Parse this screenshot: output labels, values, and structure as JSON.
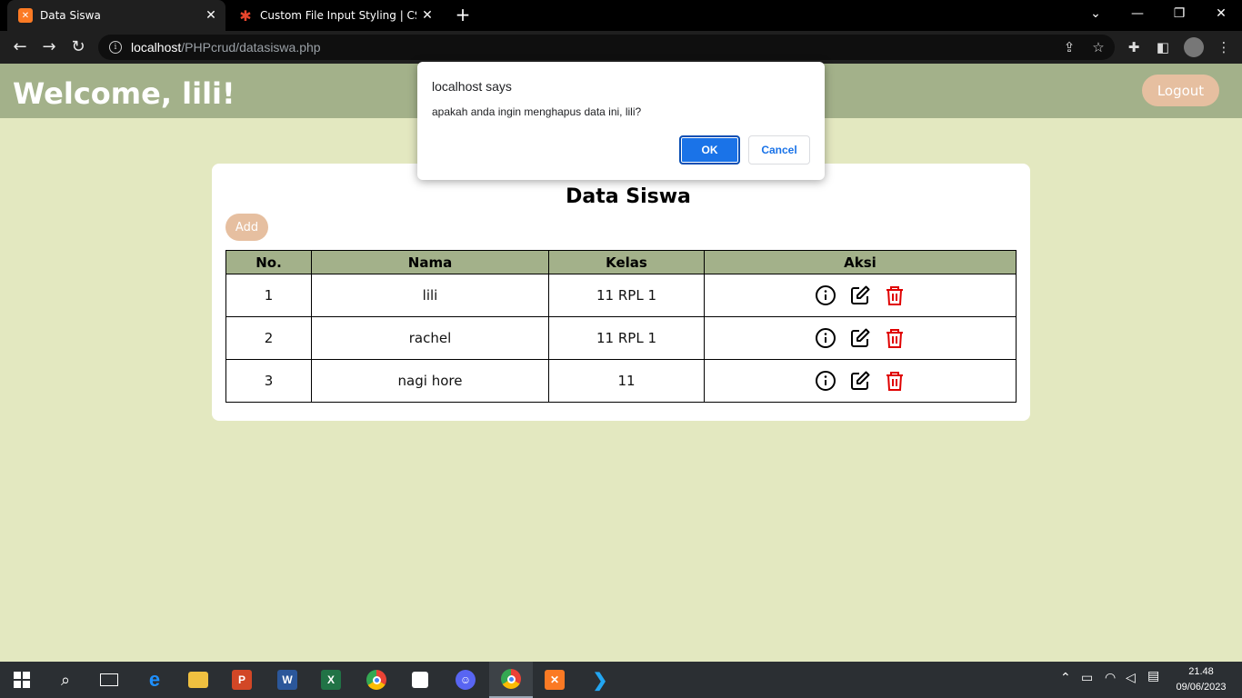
{
  "browser": {
    "tabs": [
      {
        "title": "Data Siswa",
        "active": true,
        "favicon": "xampp-icon",
        "favicon_color": "#fb7a24"
      },
      {
        "title": "Custom File Input Styling | CSS-Tr",
        "active": false,
        "favicon": "css-tricks-star-icon",
        "favicon_color": "#e8452c"
      }
    ],
    "url_host": "localhost",
    "url_path": "/PHPcrud/datasiswa.php"
  },
  "page": {
    "welcome": "Welcome, lili!",
    "logout_label": "Logout",
    "card_title": "Data Siswa",
    "add_label": "Add",
    "table": {
      "headers": [
        "No.",
        "Nama",
        "Kelas",
        "Aksi"
      ],
      "rows": [
        {
          "no": "1",
          "nama": "lili",
          "kelas": "11 RPL 1"
        },
        {
          "no": "2",
          "nama": "rachel",
          "kelas": "11 RPL 1"
        },
        {
          "no": "3",
          "nama": "nagi hore",
          "kelas": "11"
        }
      ]
    }
  },
  "dialog": {
    "from": "localhost says",
    "message": "apakah anda ingin menghapus data ini, lili?",
    "ok_label": "OK",
    "cancel_label": "Cancel"
  },
  "taskbar": {
    "time": "21.48",
    "date": "09/06/2023"
  },
  "colors": {
    "header_green": "#a3b18a",
    "page_bg": "#e3e8c0",
    "accent_peach": "#e6bfa0",
    "delete_red": "#e00000",
    "dialog_blue": "#1a73e8"
  }
}
